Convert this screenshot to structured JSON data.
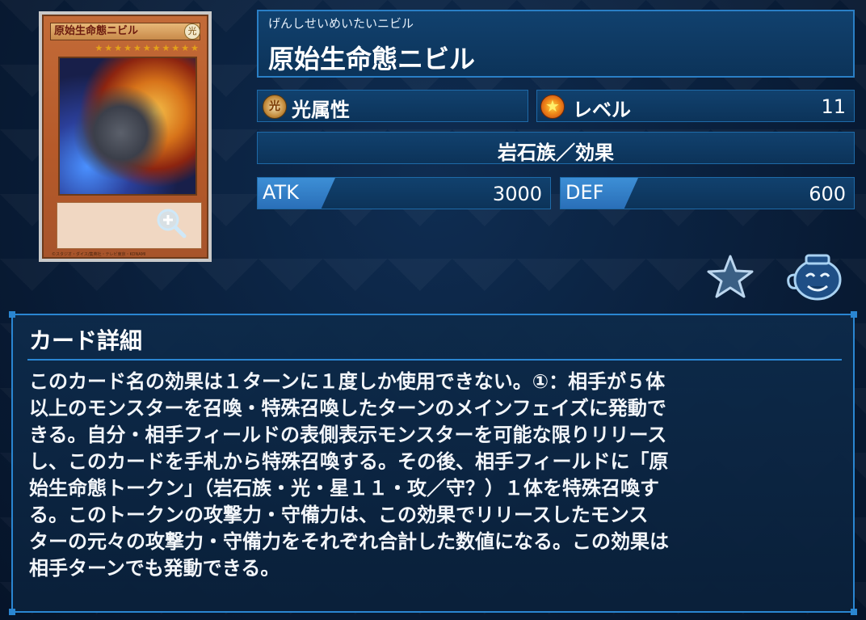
{
  "card": {
    "name": "原始生命態ニビル",
    "attribute_glyph": "光",
    "stars": "★★★★★★★★★★★",
    "fine_print": "©スタジオ・ダイス/集英社・テレビ東京・KONAMI"
  },
  "header": {
    "ruby": "げんしせいめいたいニビル",
    "title": "原始生命態ニビル"
  },
  "attribute": {
    "glyph": "光",
    "label": "光属性"
  },
  "level": {
    "label": "レベル",
    "value": "11"
  },
  "type": {
    "label": "岩石族／効果"
  },
  "stats": {
    "atk_label": "ATK",
    "atk_value": "3000",
    "def_label": "DEF",
    "def_value": "600"
  },
  "icons": {
    "favorite": "star-icon",
    "jar": "pot-of-greed-icon",
    "zoom": "magnify-plus-icon"
  },
  "description": {
    "title": "カード詳細",
    "text": "このカード名の効果は１ターンに１度しか使用できない。①：相手が５体\n以上のモンスターを召喚・特殊召喚したターンのメインフェイズに発動で\nきる。自分・相手フィールドの表側表示モンスターを可能な限りリリース\nし、このカードを手札から特殊召喚する。その後、相手フィールドに「原\n始生命態トークン」（岩石族・光・星１１・攻／守？）１体を特殊召喚す\nる。このトークンの攻撃力・守備力は、この効果でリリースしたモンス\nターの元々の攻撃力・守備力をそれぞれ合計した数値になる。この効果は\n相手ターンでも発動できる。"
  },
  "colors": {
    "accent": "#2a86d2",
    "panel": "#11416e",
    "background": "#0a1f3a"
  }
}
